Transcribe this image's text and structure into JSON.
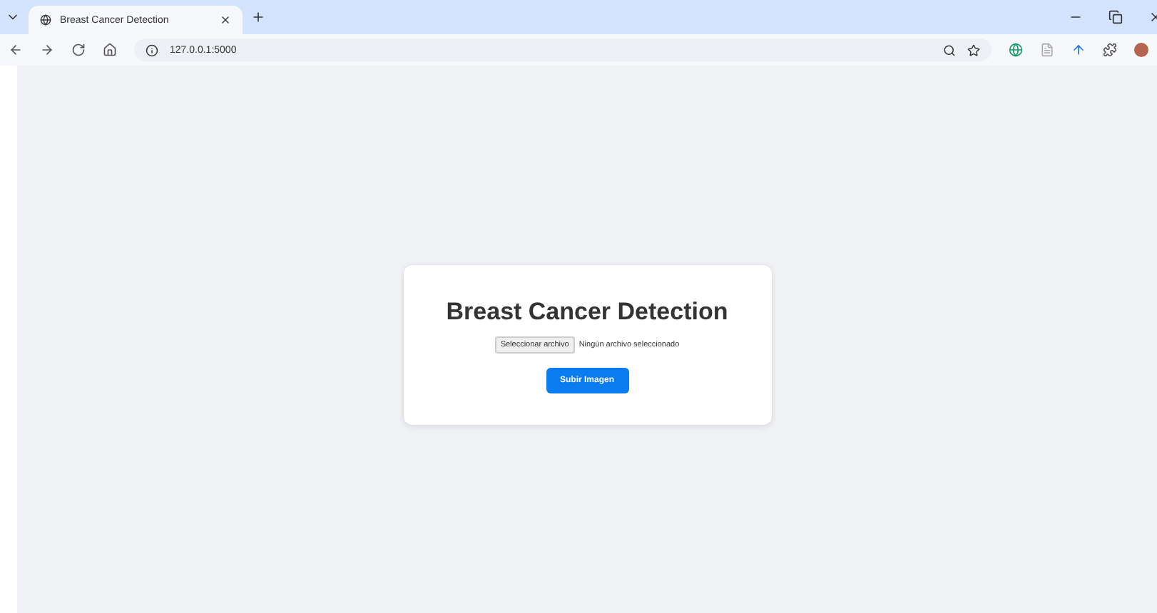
{
  "browser": {
    "tab": {
      "title": "Breast Cancer Detection",
      "selected": true
    },
    "address": "127.0.0.1:5000"
  },
  "page": {
    "title": "Breast Cancer Detection",
    "file_button": "Seleccionar archivo",
    "file_status": "Ningún archivo seleccionado",
    "submit": "Subir Imagen"
  }
}
